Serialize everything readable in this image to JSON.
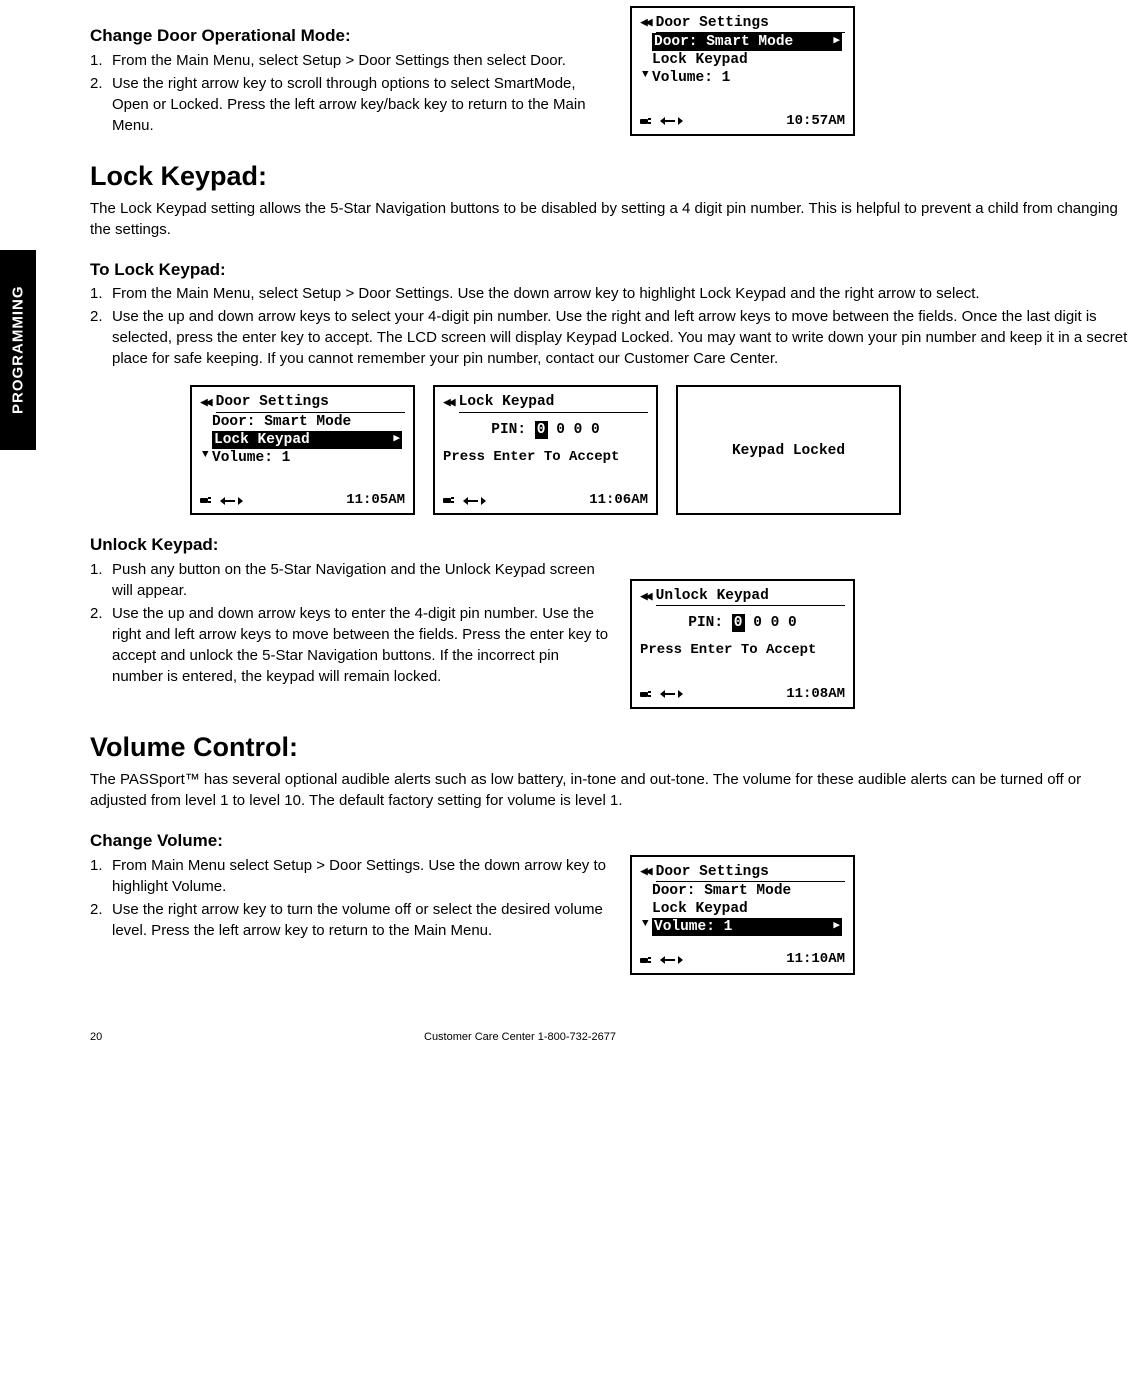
{
  "sidebar": {
    "label": "PROGRAMMING"
  },
  "section1": {
    "heading": "Change Door Operational Mode:",
    "steps": [
      "From the Main Menu, select Setup > Door Settings then select Door.",
      "Use the right arrow key to scroll through options to select SmartMode, Open or Locked. Press the left arrow key/back key to return to the Main Menu."
    ]
  },
  "lcd1": {
    "title": "Door Settings",
    "line_selected": "Door: Smart Mode",
    "line2": "Lock Keypad",
    "line3": "Volume: 1",
    "time": "10:57AM"
  },
  "section2": {
    "heading": "Lock Keypad:",
    "intro": "The Lock Keypad setting allows the 5-Star Navigation buttons to be disabled by setting a 4 digit pin number. This is helpful to prevent a child from changing the settings."
  },
  "section3": {
    "heading": "To Lock Keypad:",
    "steps": [
      "From the Main Menu, select Setup > Door Settings. Use the down arrow key to highlight Lock Keypad and the right arrow to select.",
      "Use the up and down arrow keys to select your 4-digit pin number. Use the right and left arrow keys to move between the fields. Once the last digit is selected, press the enter key to accept. The LCD screen will display Keypad Locked. You may want to write down your pin number and keep it in a secret place for safe keeping.  If you cannot remember your pin number, contact our Customer Care Center."
    ]
  },
  "lcd2": {
    "title": "Door Settings",
    "line1": "Door: Smart Mode",
    "line_selected": "Lock Keypad",
    "line3": "Volume: 1",
    "time": "11:05AM"
  },
  "lcd3": {
    "title": "Lock Keypad",
    "pin_label": "PIN:",
    "pin_sel": "0",
    "pin_rest": " 0 0 0",
    "prompt": "Press Enter To Accept",
    "time": "11:06AM"
  },
  "lcd4": {
    "text": "Keypad Locked"
  },
  "section4": {
    "heading": "Unlock Keypad:",
    "steps": [
      "Push any button on the 5-Star Navigation and the Unlock Keypad screen will appear.",
      "Use the up and down arrow keys to enter the 4-digit pin number. Use the right and left arrow keys to move between the fields. Press the enter key to accept and unlock the 5-Star Navigation buttons. If the incorrect pin number is entered, the keypad will remain locked."
    ]
  },
  "lcd5": {
    "title": "Unlock Keypad",
    "pin_label": "PIN:",
    "pin_sel": "0",
    "pin_rest": " 0 0 0",
    "prompt": "Press Enter To Accept",
    "time": "11:08AM"
  },
  "section5": {
    "heading": "Volume Control:",
    "intro": "The PASSport™ has several optional audible alerts such as low battery, in-tone and out-tone. The volume for these audible alerts can be turned off or adjusted from level 1 to level 10. The default factory setting for volume is level 1."
  },
  "section6": {
    "heading": "Change Volume:",
    "steps": [
      "From Main Menu select Setup > Door Settings. Use the down arrow key to highlight Volume.",
      "Use the right arrow key to turn the volume off or select the desired volume level. Press the left arrow key to return to the Main Menu."
    ]
  },
  "lcd6": {
    "title": "Door Settings",
    "line1": "Door: Smart Mode",
    "line2": "Lock Keypad",
    "line_selected": "Volume: 1",
    "time": "11:10AM"
  },
  "footer": {
    "page": "20",
    "care": "Customer Care Center 1-800-732-2677"
  }
}
